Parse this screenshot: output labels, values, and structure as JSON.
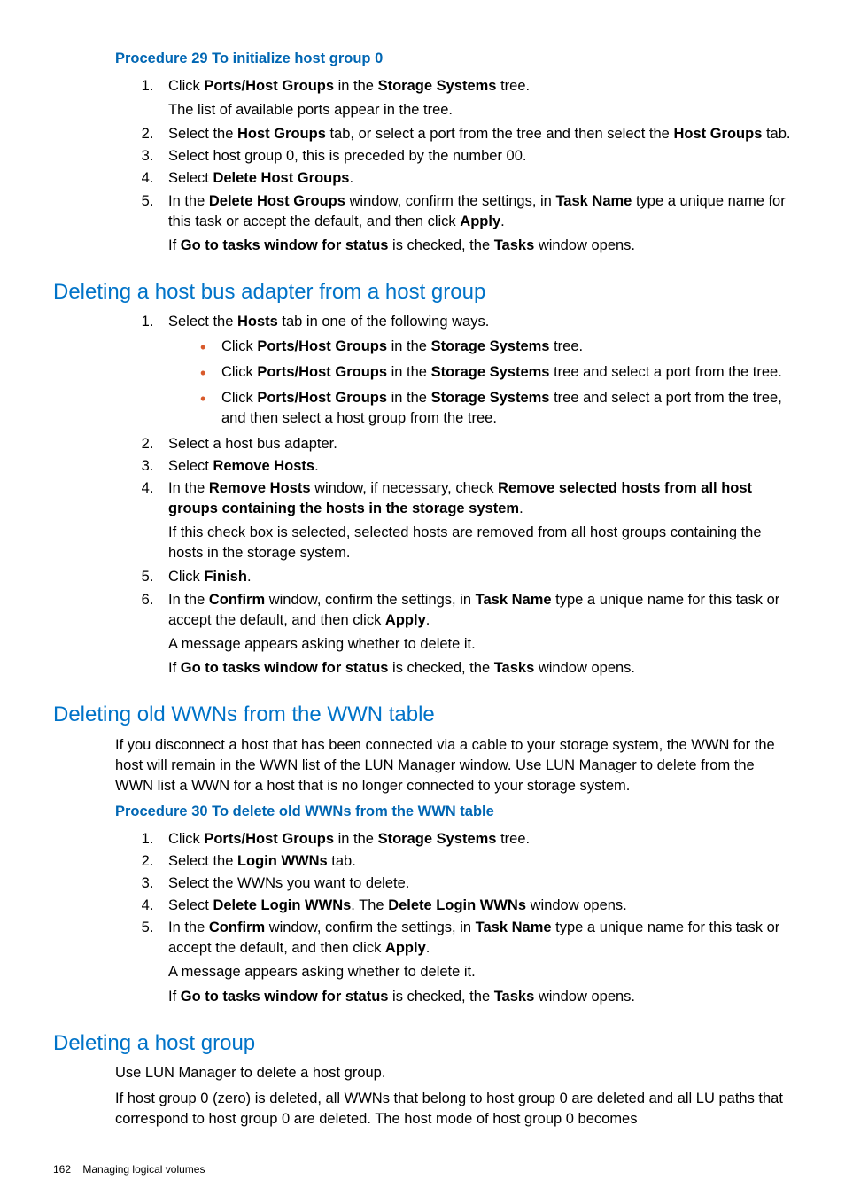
{
  "proc29": {
    "heading": "Procedure 29 To initialize host group 0",
    "s1a": "Click ",
    "s1b": "Ports/Host Groups",
    "s1c": " in the ",
    "s1d": "Storage Systems",
    "s1e": " tree.",
    "s1p": "The list of available ports appear in the tree.",
    "s2a": "Select the ",
    "s2b": "Host Groups",
    "s2c": " tab, or select a port from the tree and then select the ",
    "s2d": "Host Groups",
    "s2e": " tab.",
    "s3": "Select host group 0, this is preceded by the number 00.",
    "s4a": "Select ",
    "s4b": "Delete Host Groups",
    "s4c": ".",
    "s5a": "In the ",
    "s5b": "Delete Host Groups",
    "s5c": " window, confirm the settings, in ",
    "s5d": "Task Name",
    "s5e": " type a unique name for this task or accept the default, and then click ",
    "s5f": "Apply",
    "s5g": ".",
    "s5p1a": "If ",
    "s5p1b": "Go to tasks window for status",
    "s5p1c": " is checked, the ",
    "s5p1d": "Tasks",
    "s5p1e": " window opens."
  },
  "secA": {
    "heading": "Deleting a host bus adapter from a host group",
    "s1a": "Select the ",
    "s1b": "Hosts",
    "s1c": " tab in one of the following ways.",
    "b1a": "Click ",
    "b1b": "Ports/Host Groups",
    "b1c": " in the ",
    "b1d": "Storage Systems",
    "b1e": " tree.",
    "b2a": "Click ",
    "b2b": "Ports/Host Groups",
    "b2c": " in the ",
    "b2d": "Storage Systems",
    "b2e": " tree and select a port from the tree.",
    "b3a": "Click ",
    "b3b": "Ports/Host Groups",
    "b3c": " in the ",
    "b3d": "Storage Systems",
    "b3e": " tree and select a port from the tree, and then select a host group from the tree.",
    "s2": "Select a host bus adapter.",
    "s3a": "Select ",
    "s3b": "Remove Hosts",
    "s3c": ".",
    "s4a": "In the ",
    "s4b": "Remove Hosts",
    "s4c": " window, if necessary, check ",
    "s4d": "Remove selected hosts from all host groups containing the hosts in the storage system",
    "s4e": ".",
    "s4p": "If this check box is selected, selected hosts are removed from all host groups containing the hosts in the storage system.",
    "s5a": "Click ",
    "s5b": "Finish",
    "s5c": ".",
    "s6a": "In the ",
    "s6b": "Confirm",
    "s6c": " window, confirm the settings, in ",
    "s6d": "Task Name",
    "s6e": " type a unique name for this task or accept the default, and then click ",
    "s6f": "Apply",
    "s6g": ".",
    "s6p1": "A message appears asking whether to delete it.",
    "s6p2a": "If ",
    "s6p2b": "Go to tasks window for status",
    "s6p2c": " is checked, the ",
    "s6p2d": "Tasks",
    "s6p2e": " window opens."
  },
  "secB": {
    "heading": "Deleting old WWNs from the WWN table",
    "intro": "If you disconnect a host that has been connected via a cable to your storage system, the WWN for the host will remain in the WWN list of the LUN Manager window. Use LUN Manager to delete from the WWN list a WWN for a host that is no longer connected to your storage system.",
    "proc": "Procedure 30 To delete old WWNs from the WWN table",
    "s1a": "Click ",
    "s1b": "Ports/Host Groups",
    "s1c": " in the ",
    "s1d": "Storage Systems",
    "s1e": " tree.",
    "s2a": "Select the ",
    "s2b": "Login WWNs",
    "s2c": " tab.",
    "s3": "Select the WWNs you want to delete.",
    "s4a": "Select ",
    "s4b": "Delete Login WWNs",
    "s4c": ". The ",
    "s4d": "Delete Login WWNs",
    "s4e": " window opens.",
    "s5a": "In the ",
    "s5b": "Confirm",
    "s5c": " window, confirm the settings, in ",
    "s5d": "Task Name",
    "s5e": " type a unique name for this task or accept the default, and then click ",
    "s5f": "Apply",
    "s5g": ".",
    "s5p1": "A message appears asking whether to delete it.",
    "s5p2a": "If ",
    "s5p2b": "Go to tasks window for status",
    "s5p2c": " is checked, the ",
    "s5p2d": "Tasks",
    "s5p2e": " window opens."
  },
  "secC": {
    "heading": "Deleting a host group",
    "p1": "Use LUN Manager to delete a host group.",
    "p2": "If host group 0 (zero) is deleted, all WWNs that belong to host group 0 are deleted and all LU paths that correspond to host group 0 are deleted. The host mode of host group 0 becomes"
  },
  "footer": {
    "page": "162",
    "title": "Managing logical volumes"
  }
}
